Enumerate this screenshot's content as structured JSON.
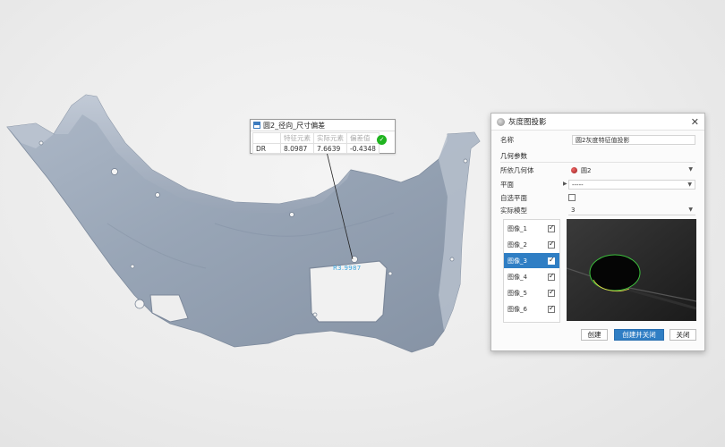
{
  "callout": {
    "title": "圆2_径向_尺寸偏差",
    "headers": [
      "",
      "特征元素",
      "实际元素",
      "偏差值"
    ],
    "row": {
      "name": "DR",
      "nominal": "8.0987",
      "actual": "7.6639",
      "deviation": "-0.4348"
    },
    "status_color": "#1fb41f"
  },
  "measure_label": "R3.9987",
  "dialog": {
    "title": "灰度图投影",
    "name_label": "名称",
    "name_value": "圆2灰度特征值投影",
    "section_geometry": "几何参数",
    "ref_geometry_label": "所依几何体",
    "ref_geometry_value": "圆2",
    "plane_label": "平面",
    "plane_value": "-----",
    "auto_plane_label": "自选平面",
    "auto_plane_checked": false,
    "image_mode_label": "实际模型",
    "image_mode_value": "3",
    "images": [
      {
        "label": "图像_1",
        "checked": true,
        "selected": false
      },
      {
        "label": "图像_2",
        "checked": true,
        "selected": false
      },
      {
        "label": "图像_3",
        "checked": true,
        "selected": true
      },
      {
        "label": "图像_4",
        "checked": true,
        "selected": false
      },
      {
        "label": "图像_5",
        "checked": true,
        "selected": false
      },
      {
        "label": "图像_6",
        "checked": true,
        "selected": false
      }
    ],
    "buttons": {
      "create": "创建",
      "create_close": "创建并关闭",
      "close": "关闭"
    },
    "accent_color": "#2f7ec4"
  }
}
